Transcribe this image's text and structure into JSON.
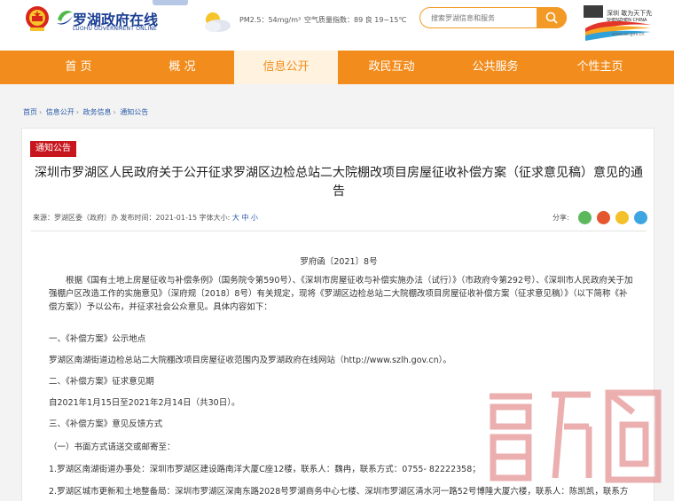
{
  "header": {
    "logo_cn": "罗湖政府在线",
    "logo_en": "LUOHU GOVERNMENT ONLINE",
    "pm25": "PM2.5：54mg/m³",
    "aqi": "空气质量指数：89 良   19~15℃",
    "search_placeholder": "搜索罗湖信息和服务",
    "sz_logo_cn": "深圳 敢为天下先",
    "sz_logo_en": "SHENZHEN CHINA",
    "sz_url": "www.sz.gov.cn",
    "colors": {
      "accent": "#f28c1c",
      "brand": "#1b3f94",
      "tag": "#c8161e"
    }
  },
  "nav": [
    {
      "label": "首 页"
    },
    {
      "label": "概 况"
    },
    {
      "label": "信息公开",
      "active": true
    },
    {
      "label": "政民互动"
    },
    {
      "label": "公共服务"
    },
    {
      "label": "个性主页"
    }
  ],
  "breadcrumb": [
    "首页",
    "信息公开",
    "政务信息",
    "通知公告"
  ],
  "article": {
    "tag": "通知公告",
    "title": "深圳市罗湖区人民政府关于公开征求罗湖区边检总站二大院棚改项目房屋征收补偿方案（征求意见稿）意见的通告",
    "meta": "来源：罗湖区委（政府）办   发布时间：2021-01-15  字体大小:",
    "size_large": "大",
    "size_medium": "中",
    "size_small": "小",
    "share_label": "分享:",
    "share_icons": [
      "wechat-icon",
      "weibo-icon",
      "qzone-icon",
      "qq-icon"
    ],
    "doc_no": "罗府函〔2021〕8号",
    "para1": "根据《国有土地上房屋征收与补偿条例》（国务院令第590号）、《深圳市房屋征收与补偿实施办法（试行）》（市政府令第292号）、《深圳市人民政府关于加强棚户区改造工作的实施意见》（深府规〔2018〕8号）有关规定，现将《罗湖区边检总站二大院棚改项目房屋征收补偿方案（征求意见稿）》（以下简称《补偿方案》）予以公布，并征求社会公众意见。具体内容如下：",
    "s1_heading": "一、《补偿方案》公示地点",
    "s1_body": "罗湖区南湖街道边检总站二大院棚改项目房屋征收范围内及罗湖政府在线网站（http://www.szlh.gov.cn）。",
    "s2_heading": "二、《补偿方案》征求意见期",
    "s2_body": "自2021年1月15日至2021年2月14日（共30日）。",
    "s3_heading": "三、《补偿方案》意见反馈方式",
    "s3_sub": "（一）书面方式请送交或邮寄至：",
    "s3_item1": "1.罗湖区南湖街道办事处：深圳市罗湖区建设路南洋大厦C座12楼，联系人：魏冉，联系方式：0755- 82222358；",
    "s3_item2": "2.罗湖区城市更新和土地整备局：深圳市罗湖区深南东路2028号罗湖商务中心七楼、深圳市罗湖区清水河一路52号博隆大厦六楼，联系人：陈凯凯，联系方"
  }
}
